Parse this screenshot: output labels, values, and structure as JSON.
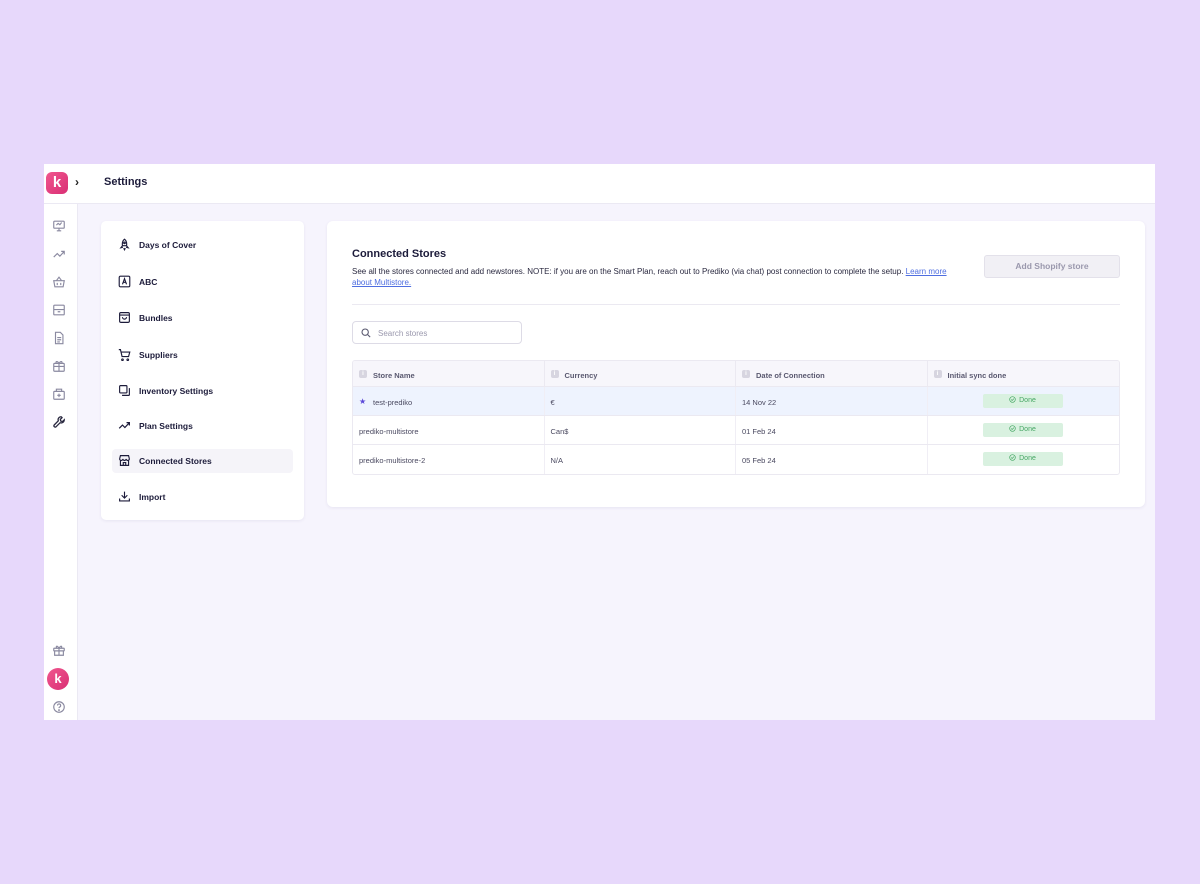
{
  "app": {
    "logo_letter": "k",
    "page_title": "Settings",
    "expand_glyph": "›"
  },
  "rail": {
    "icons": [
      "presentation-icon",
      "trend-icon",
      "basket-icon",
      "archive-icon",
      "document-icon",
      "gift-box-icon",
      "truck-box-icon",
      "wrench-icon"
    ],
    "bottom": {
      "gift_icon": "gift-icon",
      "avatar_letter": "k",
      "help_icon": "help-icon"
    }
  },
  "settings_nav": {
    "items": [
      {
        "label": "Days of Cover",
        "icon": "rocket-icon"
      },
      {
        "label": "ABC",
        "icon": "abc-icon"
      },
      {
        "label": "Bundles",
        "icon": "bag-icon"
      },
      {
        "label": "Suppliers",
        "icon": "cart-icon"
      },
      {
        "label": "Inventory Settings",
        "icon": "copy-icon"
      },
      {
        "label": "Plan Settings",
        "icon": "trend-up-icon"
      },
      {
        "label": "Connected Stores",
        "icon": "store-icon",
        "active": true
      },
      {
        "label": "Import",
        "icon": "download-icon"
      }
    ]
  },
  "connected_stores": {
    "title": "Connected Stores",
    "description": "See all the stores connected and add newstores. NOTE: if you are on the Smart Plan, reach out to Prediko (via chat) post connection to complete the setup.",
    "link_text": "Learn more about Multistore.",
    "add_button": "Add Shopify store",
    "search": {
      "placeholder": "Search stores"
    },
    "table": {
      "columns": [
        "Store Name",
        "Currency",
        "Date of Connection",
        "Initial sync done"
      ],
      "rows": [
        {
          "store": "test-prediko",
          "currency": "€",
          "date": "14 Nov 22",
          "sync": "Done",
          "primary": true
        },
        {
          "store": "prediko-multistore",
          "currency": "Can$",
          "date": "01 Feb 24",
          "sync": "Done"
        },
        {
          "store": "prediko-multistore-2",
          "currency": "N/A",
          "date": "05 Feb 24",
          "sync": "Done"
        }
      ]
    }
  },
  "colors": {
    "background": "#e7d8fb",
    "brand": "#e2417f",
    "accent": "#5b48d8",
    "success_bg": "#d9f1e0",
    "success_text": "#45a663",
    "link": "#4f6ee0"
  }
}
